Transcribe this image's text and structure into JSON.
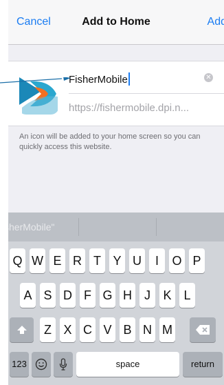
{
  "nav": {
    "cancel_label": "Cancel",
    "title": "Add to Home",
    "add_label": "Add"
  },
  "card": {
    "name_value": "FisherMobile",
    "url_value": "https://fishermobile.dpi.n..."
  },
  "hint_text": "An icon will be added to your home screen so you can quickly access this website.",
  "keyboard": {
    "prediction": "sherMobile\"",
    "row1": [
      "Q",
      "W",
      "E",
      "R",
      "T",
      "Y",
      "U",
      "I",
      "O",
      "P"
    ],
    "row2": [
      "A",
      "S",
      "D",
      "F",
      "G",
      "H",
      "J",
      "K",
      "L"
    ],
    "row3": [
      "Z",
      "X",
      "C",
      "V",
      "B",
      "N",
      "M"
    ],
    "numbers_key": "123",
    "space_key": "space",
    "return_key": "return",
    "shift_icon": "shift-icon",
    "emoji_icon": "emoji-icon",
    "mic_icon": "microphone-icon",
    "delete_icon": "delete-icon"
  },
  "colors": {
    "accent": "#1a7cf2",
    "keyboard_bg": "#d1d4d9",
    "prediction_bg": "#bcc0c6"
  }
}
